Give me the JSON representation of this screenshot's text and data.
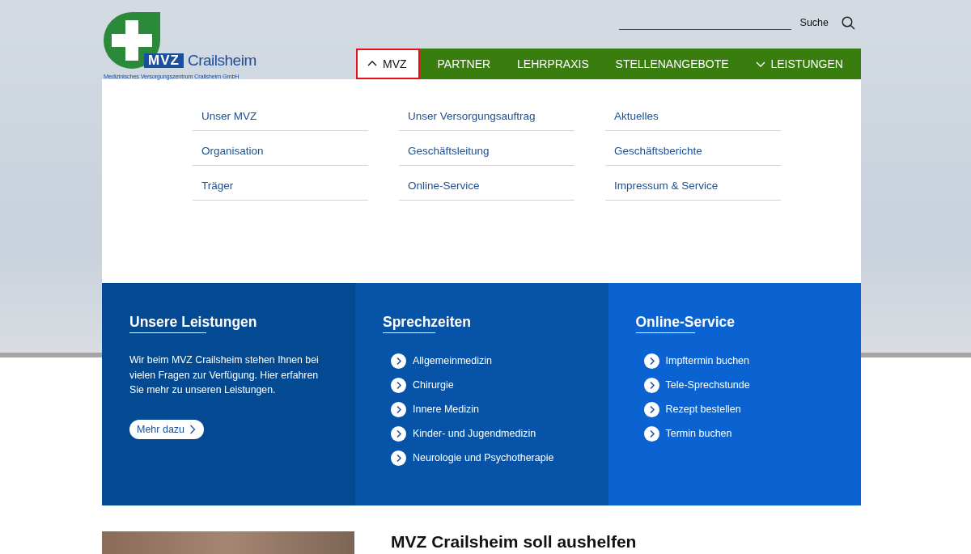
{
  "logo": {
    "mark": "MVZ",
    "name": "Crailsheim",
    "subtitle": "Medizinisches Versorgungszentrum Crailsheim GmbH"
  },
  "search": {
    "label": "Suche"
  },
  "nav": [
    {
      "label": "MVZ",
      "kind": "dropdown",
      "expanded": true,
      "selected": true
    },
    {
      "label": "PARTNER",
      "kind": "link",
      "selected": false
    },
    {
      "label": "LEHRPRAXIS",
      "kind": "link",
      "selected": false
    },
    {
      "label": "STELLENANGEBOTE",
      "kind": "link",
      "selected": false
    },
    {
      "label": "LEISTUNGEN",
      "kind": "dropdown",
      "expanded": false,
      "selected": false
    }
  ],
  "mega_menu": {
    "items": [
      "Unser MVZ",
      "Unser Versorgungsauftrag",
      "Aktuelles",
      "Organisation",
      "Geschäftsleitung",
      "Geschäftsberichte",
      "Träger",
      "Online-Service",
      "Impressum & Service"
    ]
  },
  "panels": [
    {
      "kind": "text",
      "title": "Unsere Leistungen",
      "text": "Wir beim MVZ Crailsheim stehen Ihnen bei vielen Fragen zur Verfügung. Hier erfahren Sie mehr zu unseren Leistungen.",
      "button": "Mehr dazu"
    },
    {
      "kind": "links",
      "title": "Sprechzeiten",
      "links": [
        "Allgemeinmedizin",
        "Chirurgie",
        "Innere Medizin",
        "Kinder- und Jugendmedizin",
        "Neurologie und Psychotherapie"
      ]
    },
    {
      "kind": "links",
      "title": "Online-Service",
      "links": [
        "Impftermin buchen",
        "Tele-Sprechstunde",
        "Rezept bestellen",
        "Termin buchen"
      ]
    }
  ],
  "news": {
    "title": "MVZ Crailsheim soll aushelfen"
  }
}
